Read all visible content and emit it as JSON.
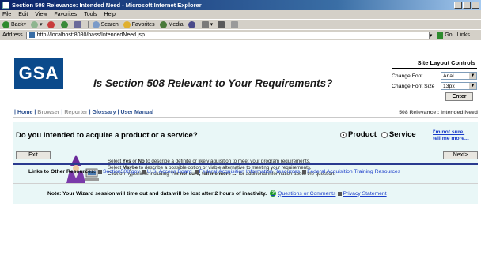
{
  "window": {
    "title": "Section 508 Relevance: Intended Need - Microsoft Internet Explorer"
  },
  "menu": [
    "File",
    "Edit",
    "View",
    "Favorites",
    "Tools",
    "Help"
  ],
  "toolbar": {
    "back": "Back",
    "search": "Search",
    "favorites": "Favorites",
    "media": "Media"
  },
  "address": {
    "label": "Address",
    "url": "http://localhost:8080/bass/IntendedNeed.jsp",
    "go": "Go",
    "links": "Links"
  },
  "logo": "GSA",
  "page_title": "Is Section 508 Relevant to Your Requirements?",
  "font_controls": {
    "title": "Site Layout Controls",
    "font_label": "Change Font",
    "font_value": "Arial",
    "size_label": "Change Font Size",
    "size_value": "13px",
    "enter": "Enter"
  },
  "nav": {
    "items": [
      {
        "label": "Home",
        "active": true
      },
      {
        "label": "Browser",
        "active": false
      },
      {
        "label": "Reporter",
        "active": false
      },
      {
        "label": "Glossary",
        "active": true
      },
      {
        "label": "User Manual",
        "active": true
      }
    ],
    "breadcrumb": "508 Relevance : Intended Need"
  },
  "question": {
    "text": "Do you intended to acquire a product or a service?",
    "options": [
      "Product",
      "Service"
    ],
    "selected": "Product",
    "not_sure_1": "I'm not sure,",
    "not_sure_2": "tell me more..."
  },
  "instructions": {
    "line1_a": "Select ",
    "line1_yes": "Yes",
    "line1_b": " or ",
    "line1_no": "No",
    "line1_c": " to describe a definite or likely aquisition to meet your program requirements.",
    "line2_a": "Select ",
    "line2_maybe": "Maybe",
    "line2_b": " to describe a possible option or viable alternative to meeting your requirements.",
    "line3_a": "Click on hyperlinks including ",
    "line3_link": "'I'm not sure, tell me more ...'",
    "line3_b": " for additional information about the question."
  },
  "buttons": {
    "exit": "Exit",
    "next": "Next>"
  },
  "resources": {
    "label": "Links to Other Resources:",
    "links": [
      "Section508.gov",
      "U.S. Access Board",
      "Federal Acquisition Information Resources",
      "Federal Acquisition Training Resources"
    ]
  },
  "footer": {
    "note": "Note: Your Wizard session will time out and data will be lost after 2 hours of inactivity.",
    "questions": "Questions or Comments",
    "privacy": "Privacy Statement"
  },
  "colors": {
    "logo_bg": "#0b4a8b",
    "panel_bg": "#e9f7f7",
    "link": "#1a3cc9",
    "nav": "#2a4f8f",
    "rule": "#2a3a8f"
  }
}
